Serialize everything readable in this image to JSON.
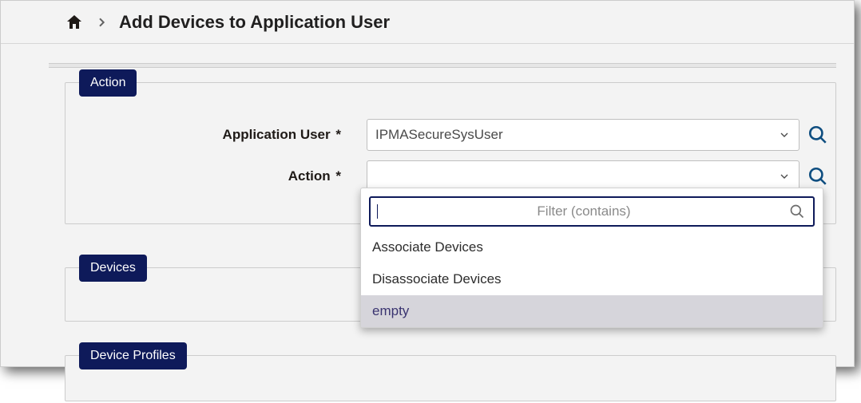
{
  "breadcrumb": {
    "title": "Add Devices to Application User"
  },
  "sections": {
    "action": {
      "label": "Action"
    },
    "devices": {
      "label": "Devices"
    },
    "device_profiles": {
      "label": "Device Profiles"
    }
  },
  "form": {
    "application_user": {
      "label": "Application User",
      "required_mark": "*",
      "value": "IPMASecureSysUser"
    },
    "action": {
      "label": "Action",
      "required_mark": "*",
      "value": ""
    }
  },
  "dropdown": {
    "filter_placeholder": "Filter (contains)",
    "options": [
      {
        "label": "Associate Devices",
        "highlighted": false
      },
      {
        "label": "Disassociate Devices",
        "highlighted": false
      },
      {
        "label": "empty",
        "highlighted": true
      }
    ]
  }
}
